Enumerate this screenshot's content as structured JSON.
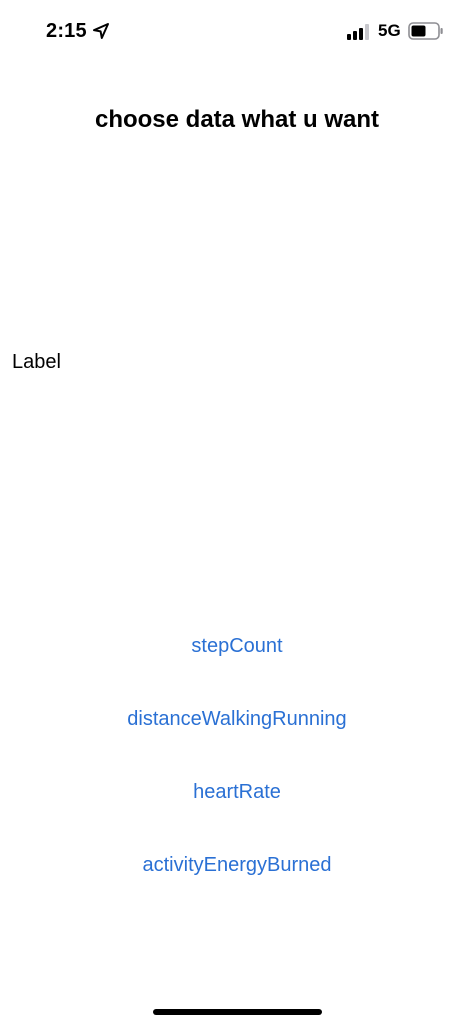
{
  "status_bar": {
    "time": "2:15",
    "network": "5G",
    "icons": [
      "location-arrow-icon",
      "cellular-signal-icon",
      "battery-icon"
    ]
  },
  "title": "choose data what u want",
  "label": "Label",
  "options": [
    "stepCount",
    "distanceWalkingRunning",
    "heartRate",
    "activityEnergyBurned"
  ],
  "colors": {
    "link": "#2a70d4",
    "text": "#000000",
    "background": "#ffffff"
  }
}
